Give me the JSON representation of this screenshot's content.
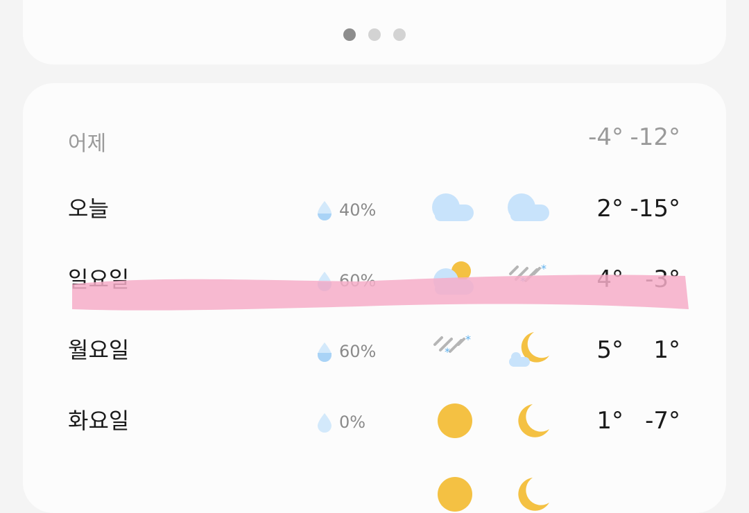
{
  "pager": {
    "dots": 3,
    "active_index": 0
  },
  "yesterday": {
    "label": "어제",
    "high": "-4°",
    "low": "-12°"
  },
  "forecast": [
    {
      "day": "오늘",
      "precip": "40%",
      "day_icon": "cloudy-icon",
      "night_icon": "cloudy-icon",
      "high": "2°",
      "low": "-15°"
    },
    {
      "day": "일요일",
      "precip": "60%",
      "day_icon": "partly-cloudy-icon",
      "night_icon": "rain-snow-icon",
      "high": "4°",
      "low": "-3°"
    },
    {
      "day": "월요일",
      "precip": "60%",
      "day_icon": "rain-snow-icon",
      "night_icon": "moon-cloud-icon",
      "high": "5°",
      "low": "1°"
    },
    {
      "day": "화요일",
      "precip": "0%",
      "day_icon": "sun-icon",
      "night_icon": "moon-icon",
      "high": "1°",
      "low": "-7°"
    }
  ],
  "colors": {
    "cloud": "#c8e3fb",
    "sun": "#f4c143",
    "drop": "#a9d3f6",
    "drop_light": "#d3e9fb",
    "highlight": "#f6adc8",
    "sleet_lines": "#b5b5b5",
    "snow": "#5fb1ee"
  }
}
